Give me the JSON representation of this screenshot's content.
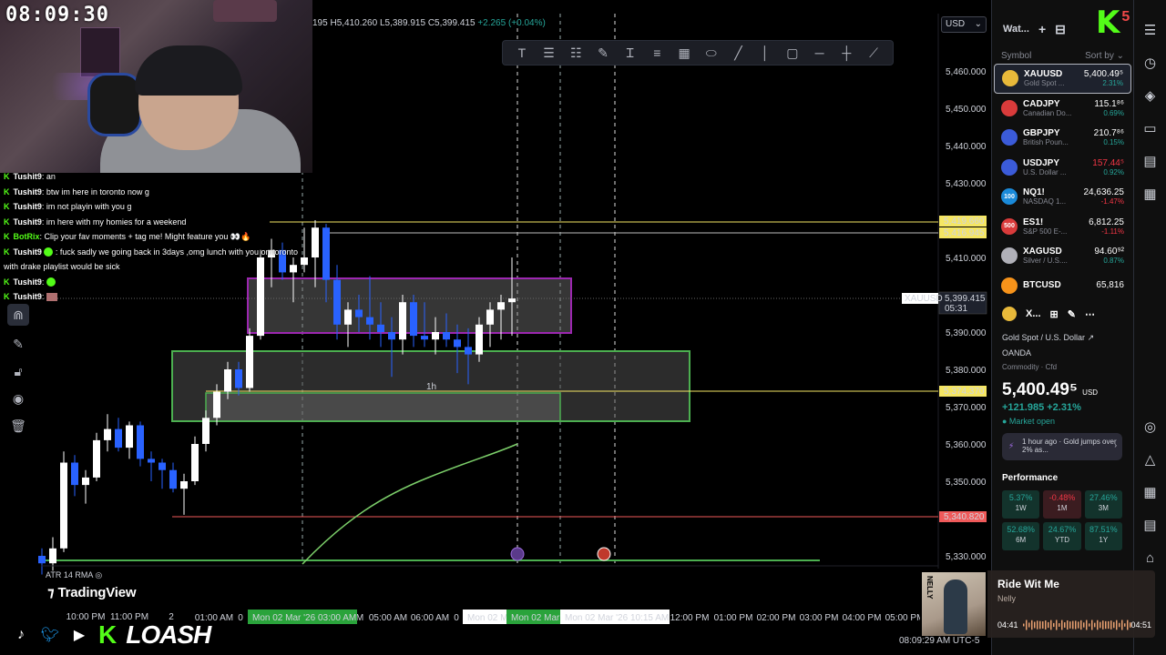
{
  "clock": "08:09:30",
  "ohlc": {
    "prefix": "195",
    "high": "H5,410.260",
    "low": "L5,389.915",
    "close": "C5,399.415",
    "change": "+2.265 (+0.04%)"
  },
  "currency": "USD",
  "chat": [
    {
      "user": "Tushit9",
      "text": ": an"
    },
    {
      "user": "Tushit9",
      "text": ": btw im here in toronto now g"
    },
    {
      "user": "Tushit9",
      "text": ": im not playin with you g"
    },
    {
      "user": "Tushit9",
      "text": ": im here with my homies for a weekend"
    },
    {
      "user": "BotRix",
      "text": ": Clip your fav moments + tag me! Might feature you 👀🔥"
    },
    {
      "user": "Tushit9",
      "text": ": fuck sadly we going back in 3days ,omg lunch with you on toronto with drake playlist would be sick"
    },
    {
      "user": "Tushit9",
      "text": ":"
    },
    {
      "user": "Tushit9",
      "text": ":"
    }
  ],
  "price_axis": [
    "5,460.000",
    "5,450.000",
    "5,440.000",
    "5,430.000",
    "5,410.000",
    "5,390.000",
    "5,380.000",
    "5,370.000",
    "5,360.000",
    "5,350.000",
    "5,340.820",
    "5,330.000"
  ],
  "price_tags": {
    "high1": "5,419.660",
    "high2": "5,416.945",
    "symbol": "XAUUSD",
    "current": "5,399.415",
    "countdown": "05:31",
    "level1": "5,374.370",
    "level2": "5,340.820"
  },
  "time_axis": [
    "01:00 AM",
    "05:00 AM",
    "06:00 AM",
    "12:00 PM",
    "01:00 PM",
    "02:00 PM",
    "03:00 PM",
    "04:00 PM",
    "05:00 PM"
  ],
  "time_axis_partial": [
    "10:00 PM",
    "11:00 PM",
    "2",
    "0",
    "0",
    "M"
  ],
  "time_highlights": [
    "Mon 02 Mar '26   03:00 AM",
    "Mon 02 Ma",
    "Mon 02 Mar '",
    "Mon 02 Mar '26   10:15 AM"
  ],
  "box_label": "1h",
  "indicator": "ATR 14 RMA",
  "tv_logo": "TradingView",
  "brand": {
    "name": "LOASH",
    "k": "K"
  },
  "watchlist": {
    "title": "Wat...",
    "col_symbol": "Symbol",
    "col_sort": "Sort by",
    "items": [
      {
        "sym": "XAUUSD",
        "desc": "Gold Spot ...",
        "price": "5,400.49⁵",
        "chg": "2.31%",
        "dir": "up",
        "icon": "",
        "color": "#e8b93a"
      },
      {
        "sym": "CADJPY",
        "desc": "Canadian Do...",
        "price": "115.1⁸⁶",
        "chg": "0.69%",
        "dir": "up",
        "icon": "",
        "color": "#d93b3b"
      },
      {
        "sym": "GBPJPY",
        "desc": "British Poun...",
        "price": "210.7⁸⁶",
        "chg": "0.15%",
        "dir": "up",
        "icon": "",
        "color": "#3b5bd9"
      },
      {
        "sym": "USDJPY",
        "desc": "U.S. Dollar ...",
        "price": "157.44⁵",
        "chg": "0.92%",
        "dir": "up",
        "icon": "",
        "color": "#3b5bd9",
        "price_red": true
      },
      {
        "sym": "NQ1!",
        "desc": "NASDAQ 1...",
        "price": "24,636.25",
        "chg": "-1.47%",
        "dir": "down",
        "icon": "100",
        "color": "#1a8ad9"
      },
      {
        "sym": "ES1!",
        "desc": "S&P 500 E-...",
        "price": "6,812.25",
        "chg": "-1.11%",
        "dir": "down",
        "icon": "500",
        "color": "#d93b3b"
      },
      {
        "sym": "XAGUSD",
        "desc": "Silver / U.S....",
        "price": "94.60⁹²",
        "chg": "0.87%",
        "dir": "up",
        "icon": "",
        "color": "#b0b0b8"
      },
      {
        "sym": "BTCUSD",
        "desc": "",
        "price": "65,816",
        "chg": "",
        "dir": "up",
        "icon": "",
        "color": "#f7931a"
      }
    ]
  },
  "details": {
    "short": "X...",
    "name": "Gold Spot / U.S. Dollar",
    "exchange": "OANDA",
    "type": "Commodity · Cfd",
    "price": "5,400.49⁵",
    "currency": "USD",
    "change": "+121.985  +2.31%",
    "market": "● Market open",
    "news": "1 hour ago · Gold jumps over 2% as...",
    "perf_title": "Performance",
    "perf": [
      {
        "val": "5.37%",
        "lbl": "1W",
        "dir": "up"
      },
      {
        "val": "-0.48%",
        "lbl": "1M",
        "dir": "down"
      },
      {
        "val": "27.46%",
        "lbl": "3M",
        "dir": "up"
      },
      {
        "val": "52.68%",
        "lbl": "6M",
        "dir": "up"
      },
      {
        "val": "24.67%",
        "lbl": "YTD",
        "dir": "up"
      },
      {
        "val": "87.51%",
        "lbl": "1Y",
        "dir": "up"
      }
    ]
  },
  "music": {
    "title": "Ride Wit Me",
    "artist": "Nelly",
    "elapsed": "04:41",
    "total": "04:51",
    "art_text": "NELLY"
  },
  "bottom_time": "08:09:29 AM UTC-5",
  "k5": {
    "k": "K",
    "n": "5"
  },
  "colors": {
    "bull": "#ffffff",
    "bear": "#2962ff",
    "accent_green": "#53fc18",
    "box_purple": "#9c27b0",
    "box_green": "#4caf50",
    "level_yellow": "#f5e663",
    "level_red": "#f05a5a"
  }
}
